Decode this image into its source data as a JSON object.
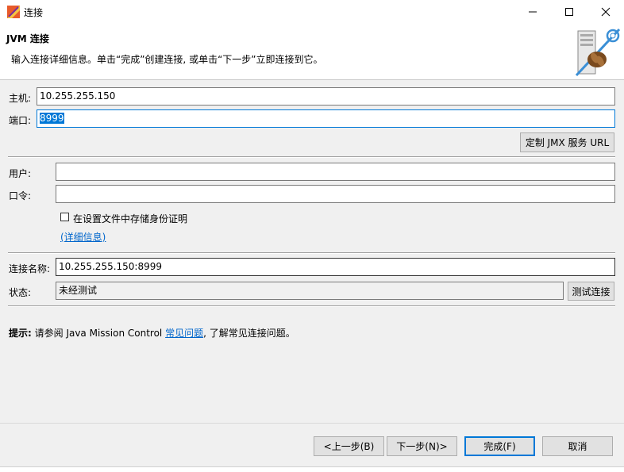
{
  "window": {
    "title": "连接",
    "icon": "eclipse-window-icon"
  },
  "banner": {
    "title": "JVM 连接",
    "description": "输入连接详细信息。单击“完成”创建连接, 或单击“下一步”立即连接到它。"
  },
  "connection": {
    "host_label": "主机:",
    "host_value": "10.255.255.150",
    "port_label": "端口:",
    "port_value": "8999",
    "jmx_button": "定制 JMX 服务 URL"
  },
  "credentials": {
    "user_label": "用户:",
    "user_value": "",
    "password_label": "口令:",
    "password_value": "",
    "store_checkbox_label": "在设置文件中存储身份证明",
    "store_checked": false,
    "details_link": "(详细信息)"
  },
  "name": {
    "label": "连接名称:",
    "value": "10.255.255.150:8999"
  },
  "status": {
    "label": "状态:",
    "value": "未经测试",
    "test_button": "测试连接"
  },
  "hint": {
    "prefix": "提示:",
    "before_link": " 请参阅 Java Mission Control ",
    "link": "常见问题",
    "after_link": ", 了解常见连接问题。"
  },
  "footer": {
    "back": "<上一步(B)",
    "next": "下一步(N)>",
    "finish": "完成(F)",
    "cancel": "取消"
  },
  "colors": {
    "accent": "#0078d7",
    "link": "#0066cc"
  }
}
